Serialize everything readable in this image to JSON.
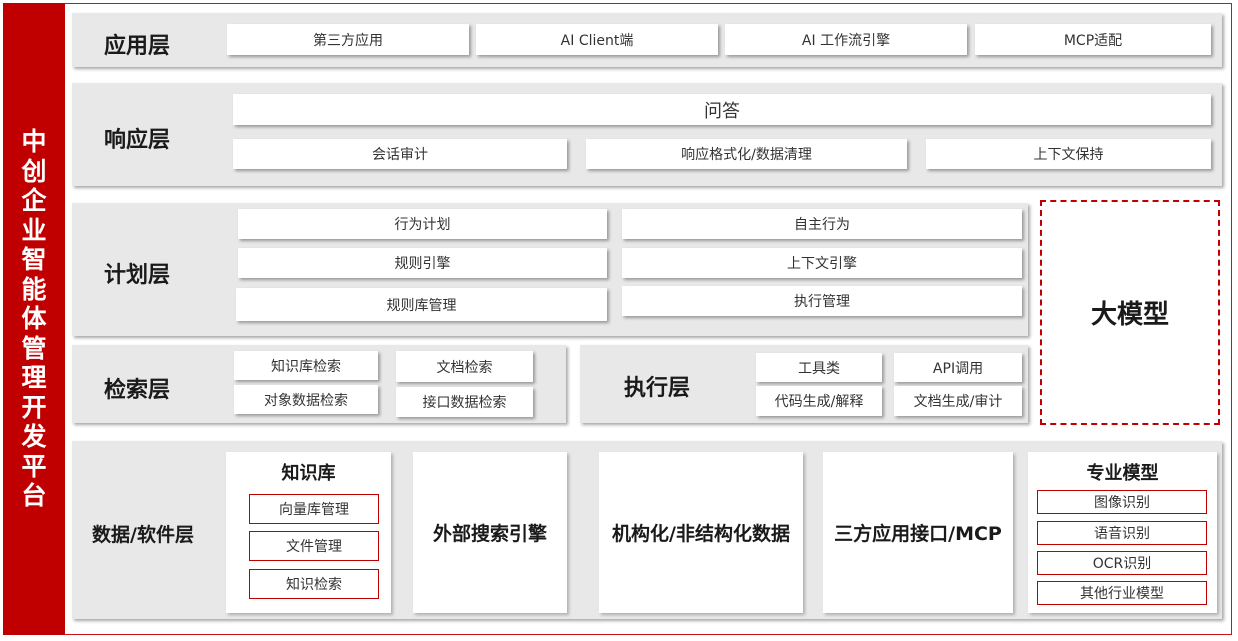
{
  "platform_title": "中创企业智能体管理开发平台",
  "app_layer": {
    "title": "应用层",
    "items": [
      "第三方应用",
      "AI Client端",
      "AI 工作流引擎",
      "MCP适配"
    ]
  },
  "response_layer": {
    "title": "响应层",
    "top": "问答",
    "items": [
      "会话审计",
      "响应格式化/数据清理",
      "上下文保持"
    ]
  },
  "plan_layer": {
    "title": "计划层",
    "left": [
      "行为计划",
      "规则引擎",
      "规则库管理"
    ],
    "right": [
      "自主行为",
      "上下文引擎",
      "执行管理"
    ]
  },
  "llm": {
    "label": "大模型"
  },
  "retrieval_layer": {
    "title": "检索层",
    "items": [
      "知识库检索",
      "文档检索",
      "对象数据检索",
      "接口数据检索"
    ]
  },
  "exec_layer": {
    "title": "执行层",
    "items": [
      "工具类",
      "API调用",
      "代码生成/解释",
      "文档生成/审计"
    ]
  },
  "data_layer": {
    "title": "数据/软件层",
    "kb": {
      "title": "知识库",
      "items": [
        "向量库管理",
        "文件管理",
        "知识检索"
      ]
    },
    "search": "外部搜索引擎",
    "structured": "机构化/非结构化数据",
    "api": "三方应用接口/MCP",
    "pro": {
      "title": "专业模型",
      "items": [
        "图像识别",
        "语音识别",
        "OCR识别",
        "其他行业模型"
      ]
    }
  },
  "colors": {
    "accent": "#c00000",
    "panel": "#e8e8e8",
    "box": "#ffffff"
  }
}
